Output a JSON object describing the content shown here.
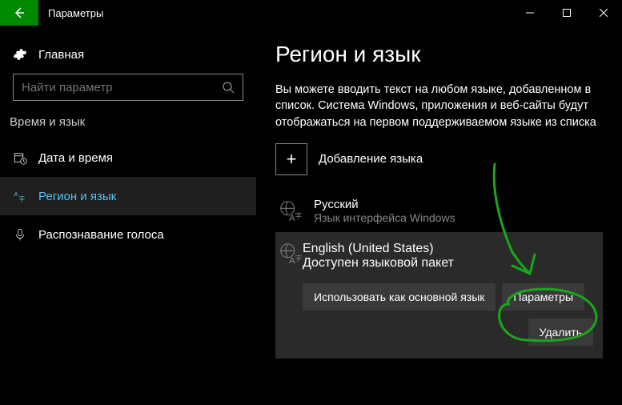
{
  "titlebar": {
    "title": "Параметры"
  },
  "sidebar": {
    "home": "Главная",
    "search_placeholder": "Найти параметр",
    "section": "Время и язык",
    "items": [
      {
        "label": "Дата и время"
      },
      {
        "label": "Регион и язык"
      },
      {
        "label": "Распознавание голоса"
      }
    ]
  },
  "main": {
    "title": "Регион и язык",
    "desc": "Вы можете вводить текст на любом языке, добавленном в список. Система Windows, приложения и веб-сайты будут отображаться на первом поддерживаемом языке из списка",
    "add_label": "Добавление языка",
    "languages": [
      {
        "name": "Русский",
        "sub": "Язык интерфейса Windows"
      },
      {
        "name": "English (United States)",
        "sub": "Доступен языковой пакет"
      }
    ],
    "buttons": {
      "set_default": "Использовать как основной язык",
      "options": "Параметры",
      "remove": "Удалить"
    }
  },
  "annotation": {
    "color": "#18a818"
  }
}
